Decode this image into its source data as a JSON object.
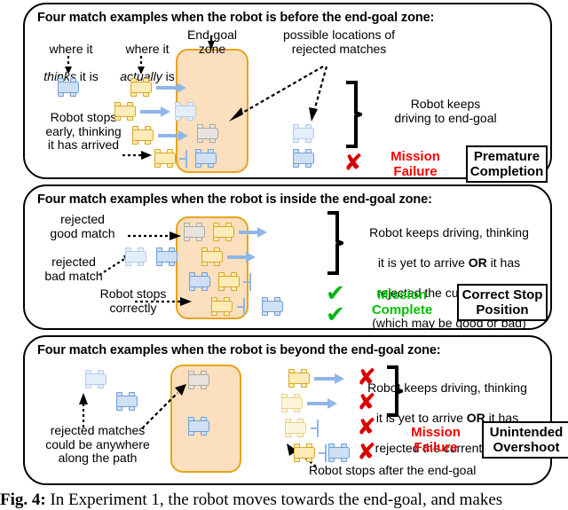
{
  "figure": {
    "caption_label": "Fig. 4:",
    "caption_text": " In Experiment 1, the robot moves towards the end-goal, and makes"
  },
  "panels": [
    {
      "id": "before",
      "title": "Four match examples when the robot is before the end-goal zone:",
      "labels": {
        "thinks": "where it",
        "thinks_em": "thinks",
        "thinks_tail": " it is",
        "actually": "where it",
        "actually_em": "actually",
        "actually_tail": " is",
        "zone": "End-goal\nzone",
        "rejected": "possible locations of\nrejected matches",
        "stops_early": "Robot stops\nearly, thinking\nit has arrived",
        "behaviour": "Robot keeps\ndriving to end-goal"
      },
      "status": "Mission\nFailure",
      "status_color": "#ff0000",
      "outcome": "Premature\nCompletion",
      "marks": [
        "x"
      ]
    },
    {
      "id": "inside",
      "title": "Four match examples when the robot is inside the end-goal zone:",
      "labels": {
        "rejected_good": "rejected\ngood match",
        "rejected_bad": "rejected\nbad match",
        "stops_correctly": "Robot stops\ncorrectly",
        "behaviour_l1": "Robot keeps driving, thinking",
        "behaviour_l2a": "it is yet to arrive ",
        "behaviour_l2b": "OR",
        "behaviour_l2c": " it has",
        "behaviour_l3": "rejected the current match",
        "behaviour_l4": "(which may be good or bad)"
      },
      "status": "Mission\nComplete",
      "status_color": "#00c000",
      "outcome": "Correct Stop\nPosition",
      "marks": [
        "check",
        "check"
      ]
    },
    {
      "id": "beyond",
      "title": "Four match examples when the robot is beyond the end-goal zone:",
      "labels": {
        "anywhere": "rejected matches\ncould be anywhere\nalong the path",
        "stops_after": "Robot stops after the end-goal",
        "behaviour_l1": "Robot keeps driving, thinking",
        "behaviour_l2a": "it is yet to arrive ",
        "behaviour_l2b": "OR",
        "behaviour_l2c": " it has",
        "behaviour_l3": "rejected the current match"
      },
      "status": "Mission\nFailure",
      "status_color": "#ff0000",
      "outcome": "Unintended\nOvershoot",
      "marks": [
        "x",
        "x",
        "x",
        "x"
      ]
    }
  ],
  "colors": {
    "zone_fill": "#fbdfbf",
    "zone_border": "#e8a317",
    "robot_blue_fill": "#cfe0f5",
    "robot_blue_stroke": "#6e9fd4",
    "robot_yellow_fill": "#fdecb8",
    "robot_yellow_stroke": "#dba520",
    "robot_grey_fill": "#e8e3de",
    "arrow_blue": "#8fb6e8",
    "failure_red": "#ff0000",
    "success_green": "#00c000",
    "mark_x_red": "#d80000"
  },
  "glyphs": {
    "x_mark": "✘",
    "check_mark": "✔"
  }
}
